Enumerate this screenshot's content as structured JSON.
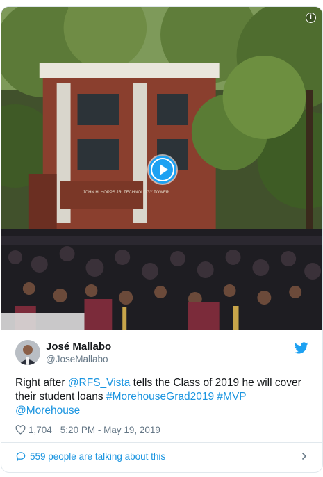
{
  "tweet": {
    "display_name": "José Mallabo",
    "handle": "@JoseMallabo",
    "text": {
      "prefix": "Right after ",
      "mention1": "@RFS_Vista",
      "middle": " tells the Class of 2019 he will cover their student loans ",
      "hashtag1": "#MorehouseGrad2019",
      "space": " ",
      "hashtag2": "#MVP",
      "mention2": "@Morehouse"
    },
    "likes": "1,704",
    "timestamp": "5:20 PM - May 19, 2019",
    "talking": "559 people are talking about this"
  },
  "media": {
    "building_sign": "JOHN H. HOPPS JR. TECHNOLOGY TOWER",
    "info_icon_glyph": "i"
  },
  "colors": {
    "link": "#1b95e0",
    "twitter_blue": "#1da1f2",
    "muted": "#657786",
    "border": "#e1e8ed"
  },
  "icons": [
    "info-icon",
    "play-icon",
    "twitter-bird-icon",
    "heart-icon",
    "speech-bubble-icon",
    "chevron-right-icon"
  ]
}
